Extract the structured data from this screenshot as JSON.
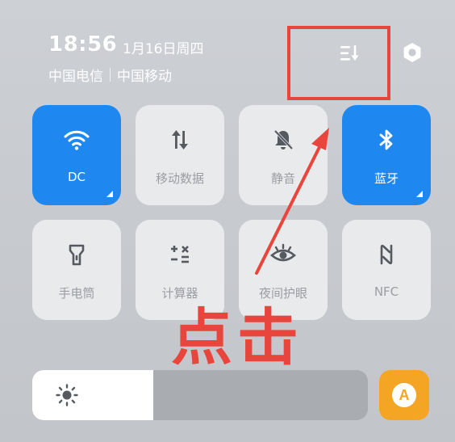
{
  "status": {
    "time": "18:56",
    "date": "1月16日周四",
    "carriers": [
      "中国电信",
      "中国移动"
    ]
  },
  "header_icons": {
    "edit": "edit-tiles-icon",
    "settings": "settings-icon"
  },
  "tiles": [
    {
      "label": "DC",
      "icon": "wifi-icon",
      "active": true
    },
    {
      "label": "移动数据",
      "icon": "mobile-data-icon",
      "active": false
    },
    {
      "label": "静音",
      "icon": "bell-off-icon",
      "active": false
    },
    {
      "label": "蓝牙",
      "icon": "bluetooth-icon",
      "active": true
    },
    {
      "label": "手电筒",
      "icon": "flashlight-icon",
      "active": false
    },
    {
      "label": "计算器",
      "icon": "calculator-icon",
      "active": false
    },
    {
      "label": "夜间护眼",
      "icon": "eye-icon",
      "active": false
    },
    {
      "label": "NFC",
      "icon": "nfc-icon",
      "active": false
    }
  ],
  "annotation": {
    "text": "点击",
    "color": "#e8463c"
  },
  "brightness": {
    "level": 0.36,
    "icon": "sun-icon"
  },
  "auto_brightness": {
    "label": "A",
    "color": "#f5a524"
  },
  "colors": {
    "accent": "#1e88f0",
    "tile_inactive": "#e9eaec",
    "annotation_red": "#e8463c"
  }
}
